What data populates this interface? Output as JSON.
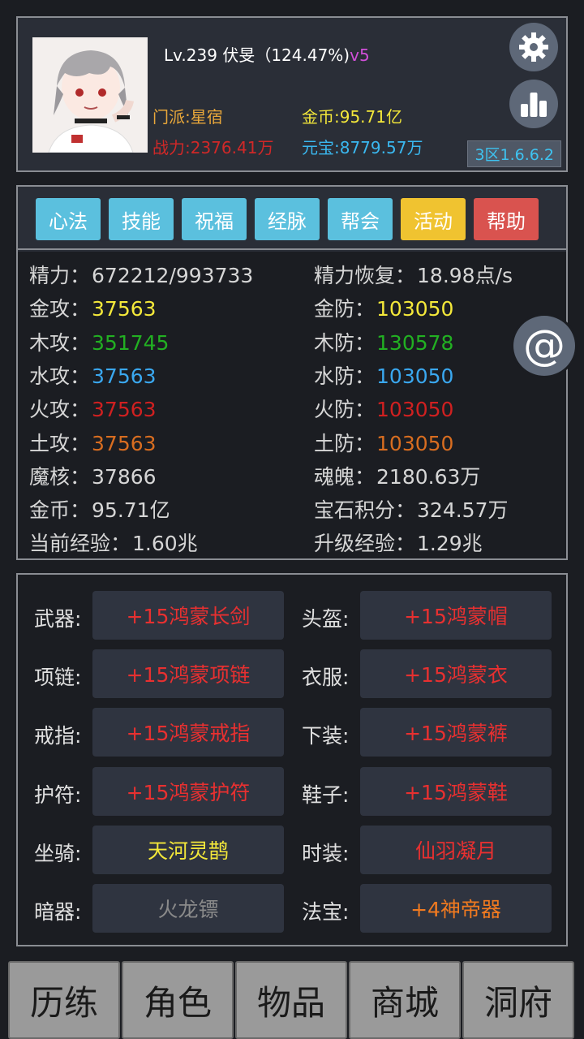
{
  "player": {
    "level_line": "Lv.239 伏旻（124.47%)",
    "vip": "v5",
    "sect": "门派:星宿",
    "power": "战力:2376.41万",
    "gold": "金币:95.71亿",
    "ingot": "元宝:8779.57万",
    "server": "3区1.6.6.2"
  },
  "icons": {
    "settings": "gear-icon",
    "stats": "bar-chart-icon",
    "chat": "at-sign-icon"
  },
  "tabs": [
    {
      "label": "心法",
      "color": "#5bc0de"
    },
    {
      "label": "技能",
      "color": "#5bc0de"
    },
    {
      "label": "祝福",
      "color": "#5bc0de"
    },
    {
      "label": "经脉",
      "color": "#5bc0de"
    },
    {
      "label": "帮会",
      "color": "#5bc0de"
    },
    {
      "label": "活动",
      "color": "#f0c330"
    },
    {
      "label": "帮助",
      "color": "#d9534f"
    }
  ],
  "attributes": {
    "left": [
      {
        "label": "精力：",
        "value": "672212/993733",
        "color": "#d6d6d6"
      },
      {
        "label": "金攻：",
        "value": "37563",
        "color": "#f4e83a"
      },
      {
        "label": "木攻：",
        "value": "351745",
        "color": "#22b022"
      },
      {
        "label": "水攻：",
        "value": "37563",
        "color": "#3aa8f0"
      },
      {
        "label": "火攻：",
        "value": "37563",
        "color": "#d02020"
      },
      {
        "label": "土攻：",
        "value": "37563",
        "color": "#d86d20"
      },
      {
        "label": "魔核：",
        "value": "37866",
        "color": "#d6d6d6"
      },
      {
        "label": "金币：",
        "value": "95.71亿",
        "color": "#d6d6d6"
      },
      {
        "label": "当前经验：",
        "value": "1.60兆",
        "color": "#d6d6d6"
      }
    ],
    "right": [
      {
        "label": "精力恢复：",
        "value": "18.98点/s",
        "color": "#d6d6d6"
      },
      {
        "label": "金防：",
        "value": "103050",
        "color": "#f4e83a"
      },
      {
        "label": "木防：",
        "value": "130578",
        "color": "#22b022"
      },
      {
        "label": "水防：",
        "value": "103050",
        "color": "#3aa8f0"
      },
      {
        "label": "火防：",
        "value": "103050",
        "color": "#d02020"
      },
      {
        "label": "土防：",
        "value": "103050",
        "color": "#d86d20"
      },
      {
        "label": "魂魄：",
        "value": "2180.63万",
        "color": "#d6d6d6"
      },
      {
        "label": "宝石积分：",
        "value": "324.57万",
        "color": "#d6d6d6"
      },
      {
        "label": "升级经验：",
        "value": "1.29兆",
        "color": "#d6d6d6"
      }
    ]
  },
  "equipment": {
    "left": [
      {
        "slot": "武器:",
        "item": "+15鸿蒙长剑",
        "color": "#e83030"
      },
      {
        "slot": "项链:",
        "item": "+15鸿蒙项链",
        "color": "#e83030"
      },
      {
        "slot": "戒指:",
        "item": "+15鸿蒙戒指",
        "color": "#e83030"
      },
      {
        "slot": "护符:",
        "item": "+15鸿蒙护符",
        "color": "#e83030"
      },
      {
        "slot": "坐骑:",
        "item": "天河灵鹊",
        "color": "#f4e83a"
      },
      {
        "slot": "暗器:",
        "item": "火龙镖",
        "color": "#8a8a8a"
      }
    ],
    "right": [
      {
        "slot": "头盔:",
        "item": "+15鸿蒙帽",
        "color": "#e83030"
      },
      {
        "slot": "衣服:",
        "item": "+15鸿蒙衣",
        "color": "#e83030"
      },
      {
        "slot": "下装:",
        "item": "+15鸿蒙裤",
        "color": "#e83030"
      },
      {
        "slot": "鞋子:",
        "item": "+15鸿蒙鞋",
        "color": "#e83030"
      },
      {
        "slot": "时装:",
        "item": "仙羽凝月",
        "color": "#e83030"
      },
      {
        "slot": "法宝:",
        "item": "+4神帝器",
        "color": "#f07a20"
      }
    ]
  },
  "nav": [
    "历练",
    "角色",
    "物品",
    "商城",
    "洞府"
  ]
}
